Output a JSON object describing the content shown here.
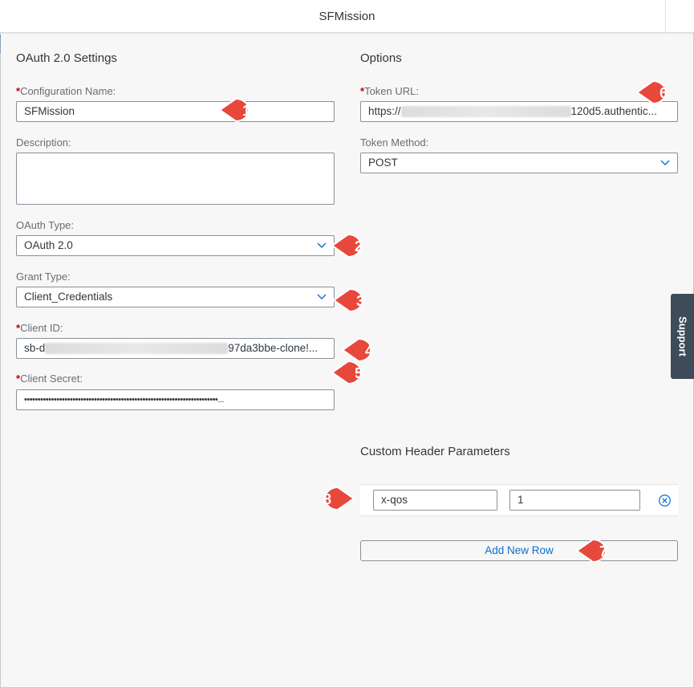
{
  "header": {
    "title": "SFMission"
  },
  "left": {
    "section_title": "OAuth 2.0 Settings",
    "config_name": {
      "required": "*",
      "label": "Configuration Name:",
      "value": "SFMission"
    },
    "description": {
      "label": "Description:",
      "value": ""
    },
    "oauth_type": {
      "label": "OAuth Type:",
      "value": "OAuth 2.0"
    },
    "grant_type": {
      "label": "Grant Type:",
      "value": "Client_Credentials"
    },
    "client_id": {
      "required": "*",
      "label": "Client ID:",
      "value_start": "sb-d",
      "value_end": "97da3bbe-clone!..."
    },
    "client_secret": {
      "required": "*",
      "label": "Client Secret:",
      "value": "••••••••••••••••••••••••••••••••••••••••••••••••••••••••••••••••••••••••..."
    }
  },
  "right": {
    "section_title": "Options",
    "token_url": {
      "required": "*",
      "label": "Token URL:",
      "value_start": "https://",
      "value_end": "120d5.authentic..."
    },
    "token_method": {
      "label": "Token Method:",
      "value": "POST"
    },
    "custom_header": {
      "title": "Custom Header Parameters",
      "rows": [
        {
          "key": "x-qos",
          "value": "1"
        }
      ],
      "add_row_label": "Add New Row"
    }
  },
  "support_tab": {
    "label": "Support"
  },
  "callouts": [
    "1",
    "2",
    "3",
    "4",
    "5",
    "6",
    "7",
    "8"
  ],
  "colors": {
    "callout": "#e8473b",
    "accent": "#0a6ed1",
    "required": "#bb0000",
    "support_tab": "#3e4b58"
  }
}
